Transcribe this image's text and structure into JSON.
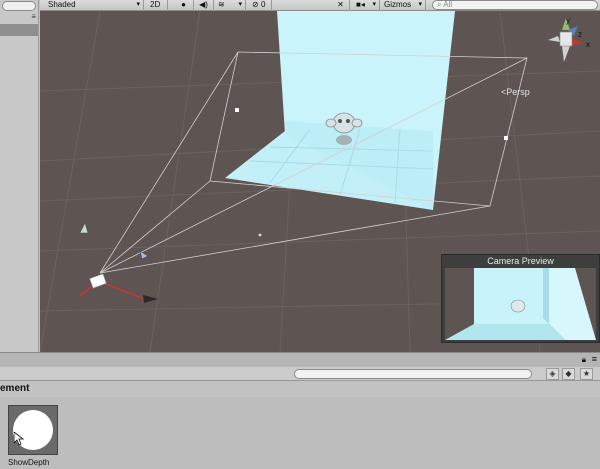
{
  "scene_toolbar": {
    "draw_mode": "Shaded",
    "mode_2d": "2D",
    "fx_count": "0",
    "gizmos_label": "Gizmos",
    "search_placeholder": "All"
  },
  "scene": {
    "projection_label": "Persp",
    "axis_labels": {
      "y": "y",
      "z": "z",
      "x": "x"
    }
  },
  "camera_preview": {
    "title": "Camera Preview"
  },
  "project": {
    "breadcrumb": "ement",
    "assets": [
      {
        "name": "ShowDepth"
      }
    ]
  },
  "colors": {
    "scene_bg": "#5e5451",
    "backdrop": "#c6f3fb",
    "toolbar": "#cfcfcf"
  }
}
